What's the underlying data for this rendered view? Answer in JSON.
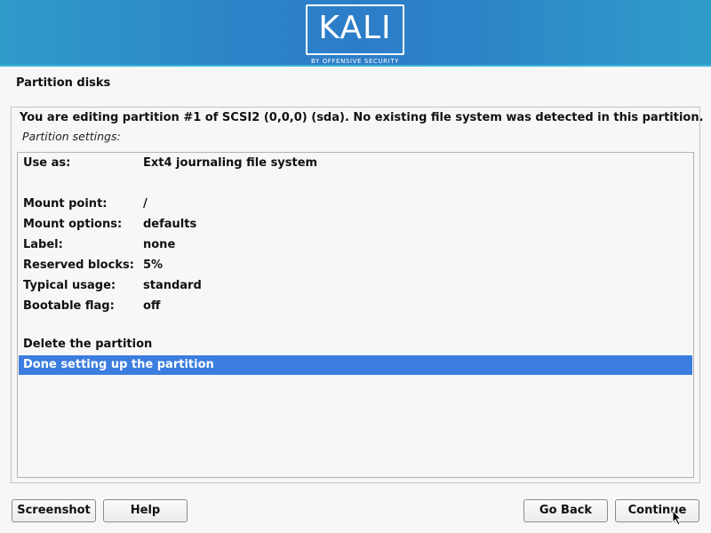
{
  "banner": {
    "logo_text": "KALI",
    "logo_subtitle": "BY OFFENSIVE SECURITY"
  },
  "page_title": "Partition disks",
  "description": "You are editing partition #1 of SCSI2 (0,0,0) (sda). No existing file system was detected in this partition.",
  "subtitle": "Partition settings:",
  "settings": [
    {
      "key": "Use as:",
      "value": "Ext4 journaling file system"
    },
    {
      "key": "Mount point:",
      "value": "/"
    },
    {
      "key": "Mount options:",
      "value": "defaults"
    },
    {
      "key": "Label:",
      "value": "none"
    },
    {
      "key": "Reserved blocks:",
      "value": "5%"
    },
    {
      "key": "Typical usage:",
      "value": "standard"
    },
    {
      "key": "Bootable flag:",
      "value": "off"
    }
  ],
  "actions": [
    {
      "label": "Delete the partition",
      "selected": false
    },
    {
      "label": "Done setting up the partition",
      "selected": true
    }
  ],
  "buttons": {
    "screenshot": "Screenshot",
    "help": "Help",
    "go_back": "Go Back",
    "continue": "Continue"
  },
  "colors": {
    "banner": "#2c7dc8",
    "selection": "#3c7de0"
  }
}
